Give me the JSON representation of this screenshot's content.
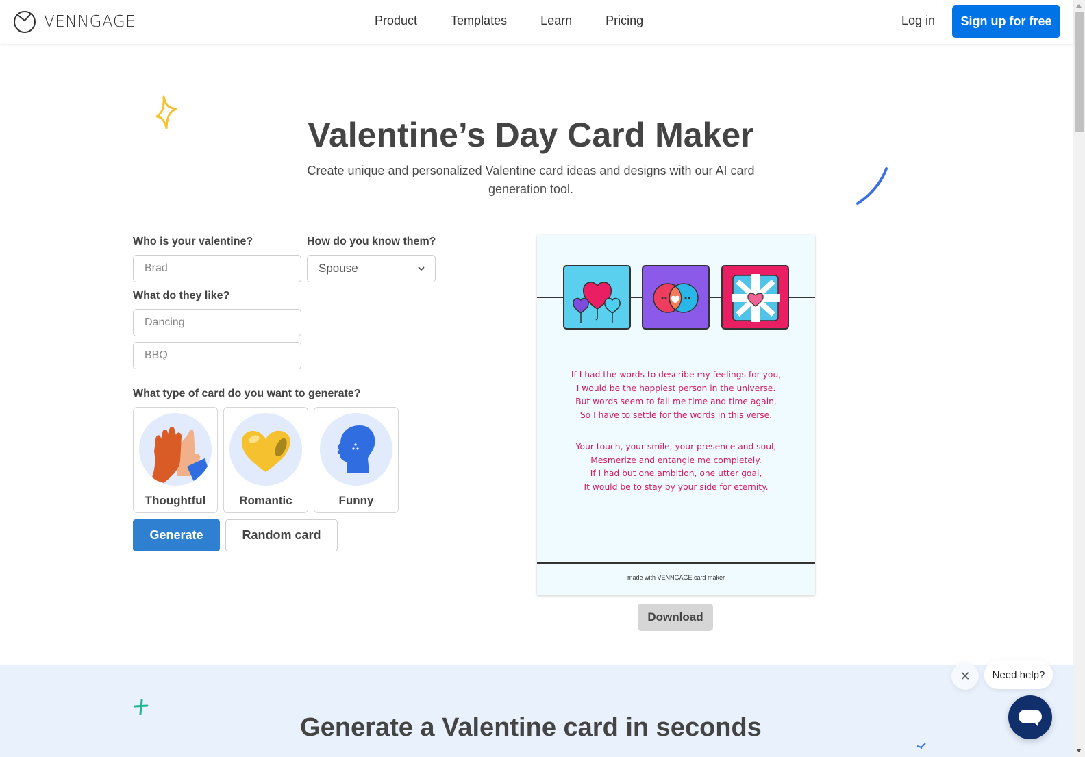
{
  "navbar": {
    "brand": "VENNGAGE",
    "links": [
      "Product",
      "Templates",
      "Learn",
      "Pricing"
    ],
    "login_label": "Log in",
    "signup_label": "Sign up for free"
  },
  "hero": {
    "title": "Valentine’s Day Card Maker",
    "subtitle": "Create unique and personalized Valentine card ideas and designs with our AI card generation tool."
  },
  "form": {
    "valentine_label": "Who is your valentine?",
    "valentine_placeholder": "Brad",
    "relation_label": "How do you know them?",
    "relation_value": "Spouse",
    "likes_label": "What do they like?",
    "like1_placeholder": "Dancing",
    "like2_placeholder": "BBQ",
    "type_label": "What type of card do you want to generate?",
    "types": [
      {
        "label": "Thoughtful",
        "icon": "high-five-icon"
      },
      {
        "label": "Romantic",
        "icon": "heart-icon"
      },
      {
        "label": "Funny",
        "icon": "laughing-head-icon"
      }
    ],
    "generate_label": "Generate",
    "random_label": "Random card"
  },
  "card": {
    "tiles": [
      "balloons-icon",
      "chat-bubbles-icon",
      "gift-icon"
    ],
    "stanza1": [
      "If I had the words to describe my feelings for you,",
      "I would be the happiest person in the universe.",
      "But words seem to fail me time and time again,",
      "So I have to settle for the words in this verse."
    ],
    "stanza2": [
      "Your touch, your smile, your presence and soul,",
      "Mesmerize and entangle me completely.",
      "If I had but one ambition, one utter goal,",
      "It would be to stay by your side for eternity."
    ],
    "footer": "made with VENNGAGE card maker",
    "download_label": "Download"
  },
  "section2": {
    "title": "Generate a Valentine card in seconds"
  },
  "chat": {
    "prompt": "Need help?",
    "close_glyph": "✕"
  },
  "colors": {
    "brand_blue": "#0073e6",
    "generate_blue": "#2f80d1",
    "poem_pink": "#d6195e",
    "card_bg": "#effbfe",
    "chat_navy": "#112f6b"
  }
}
